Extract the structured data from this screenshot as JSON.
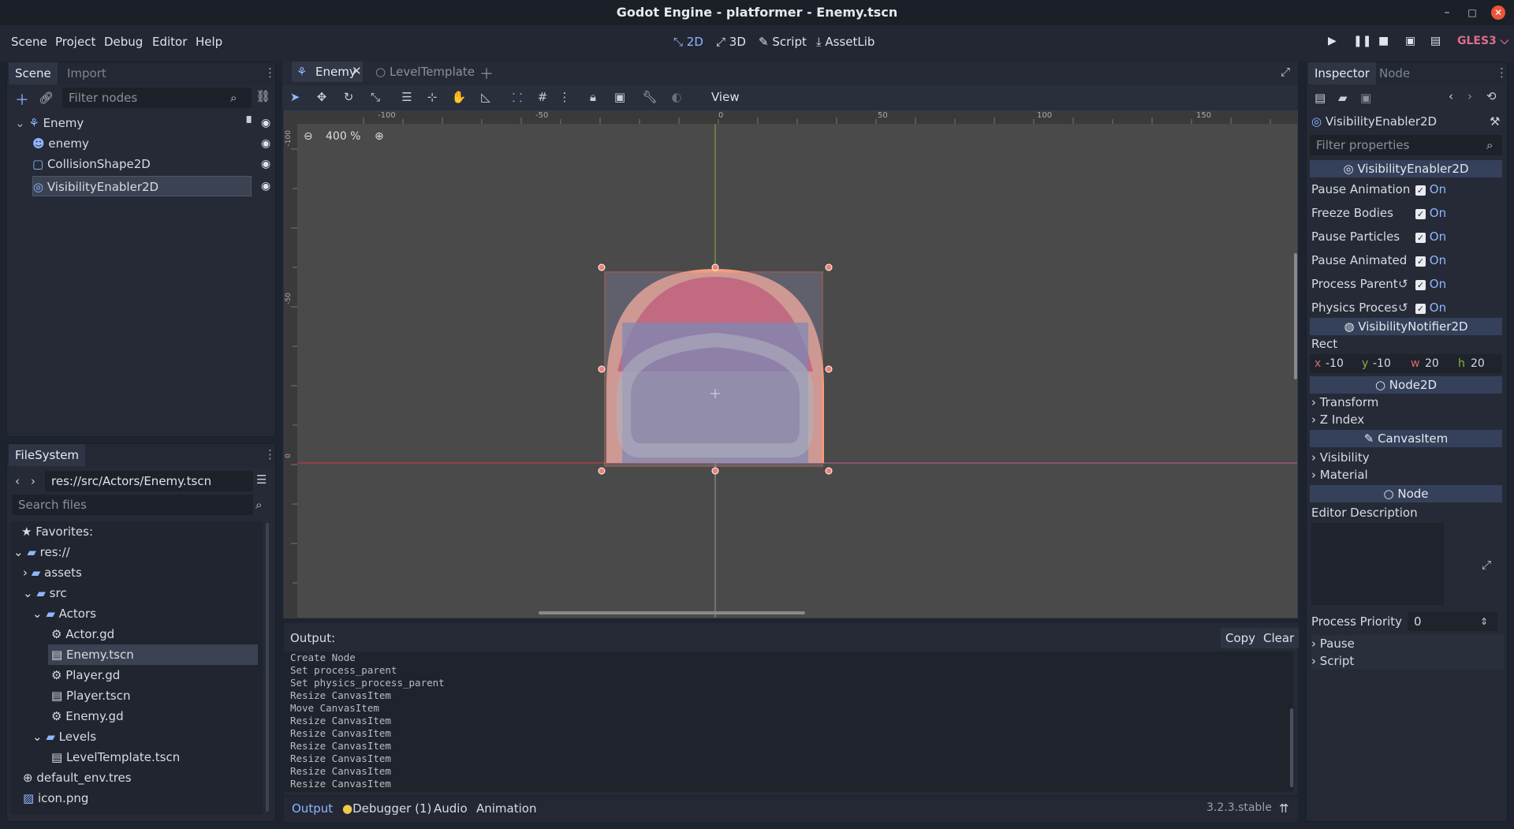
{
  "window": {
    "title": "Godot Engine - platformer - Enemy.tscn",
    "minimize": "–",
    "maximize": "□",
    "close": "✕"
  },
  "menus": [
    "Scene",
    "Project",
    "Debug",
    "Editor",
    "Help"
  ],
  "workspaces": {
    "2d": "2D",
    "3d": "3D",
    "script": "Script",
    "assetlib": "AssetLib"
  },
  "renderer": "GLES3 ⌵",
  "scene_dock": {
    "tabs": [
      "Scene",
      "Import"
    ],
    "filter_placeholder": "Filter nodes",
    "nodes": [
      {
        "name": "Enemy"
      },
      {
        "name": "enemy"
      },
      {
        "name": "CollisionShape2D"
      },
      {
        "name": "VisibilityEnabler2D"
      }
    ]
  },
  "filesystem": {
    "tab": "FileSystem",
    "path": "res://src/Actors/Enemy.tscn",
    "search_placeholder": "Search files",
    "items": [
      "Favorites:",
      "res://",
      "assets",
      "src",
      "Actors",
      "Actor.gd",
      "Enemy.tscn",
      "Player.gd",
      "Player.tscn",
      "Enemy.gd",
      "Levels",
      "LevelTemplate.tscn",
      "default_env.tres",
      "icon.png"
    ]
  },
  "editor_tabs": [
    "Enemy",
    "LevelTemplate"
  ],
  "toolbar": {
    "view": "View"
  },
  "viewport": {
    "zoom": "400 %",
    "ruler_labels": [
      "-100",
      "-50",
      "0",
      "50",
      "100",
      "150"
    ],
    "vruler_labels": [
      "-100",
      "-50",
      "0"
    ]
  },
  "output": {
    "title": "Output:",
    "copy": "Copy",
    "clear": "Clear",
    "lines": [
      "Create Node",
      "Set process_parent",
      "Set physics_process_parent",
      "Resize CanvasItem",
      "Move CanvasItem",
      "Resize CanvasItem",
      "Resize CanvasItem",
      "Resize CanvasItem",
      "Resize CanvasItem",
      "Resize CanvasItem",
      "Resize CanvasItem"
    ]
  },
  "bottom_tabs": [
    "Output",
    "Debugger (1)",
    "Audio",
    "Animation"
  ],
  "version": "3.2.3.stable",
  "inspector": {
    "tabs": [
      "Inspector",
      "Node"
    ],
    "object": "VisibilityEnabler2D",
    "filter_placeholder": "Filter properties",
    "section1": "VisibilityEnabler2D",
    "props": [
      {
        "label": "Pause Animation",
        "value": "On"
      },
      {
        "label": "Freeze Bodies",
        "value": "On"
      },
      {
        "label": "Pause Particles",
        "value": "On"
      },
      {
        "label": "Pause Animated",
        "value": "On"
      },
      {
        "label": "Process Parent",
        "value": "On"
      },
      {
        "label": "Physics Proces",
        "value": "On"
      }
    ],
    "section2": "VisibilityNotifier2D",
    "rect_label": "Rect",
    "rect": {
      "x_label": "x",
      "x": "-10",
      "y_label": "y",
      "y": "-10",
      "w_label": "w",
      "w": "20",
      "h_label": "h",
      "h": "20"
    },
    "section3": "Node2D",
    "transform": "Transform",
    "zindex": "Z Index",
    "section4": "CanvasItem",
    "visibility": "Visibility",
    "material": "Material",
    "section5": "Node",
    "editor_description": "Editor Description",
    "process_priority_label": "Process Priority",
    "process_priority": "0",
    "pause": "Pause",
    "script": "Script"
  },
  "colors": {
    "accent": "#8fb7ff",
    "bg": "#1e2330",
    "panel": "#252a36",
    "close": "#e9553a",
    "renderer": "#e06c8a"
  }
}
